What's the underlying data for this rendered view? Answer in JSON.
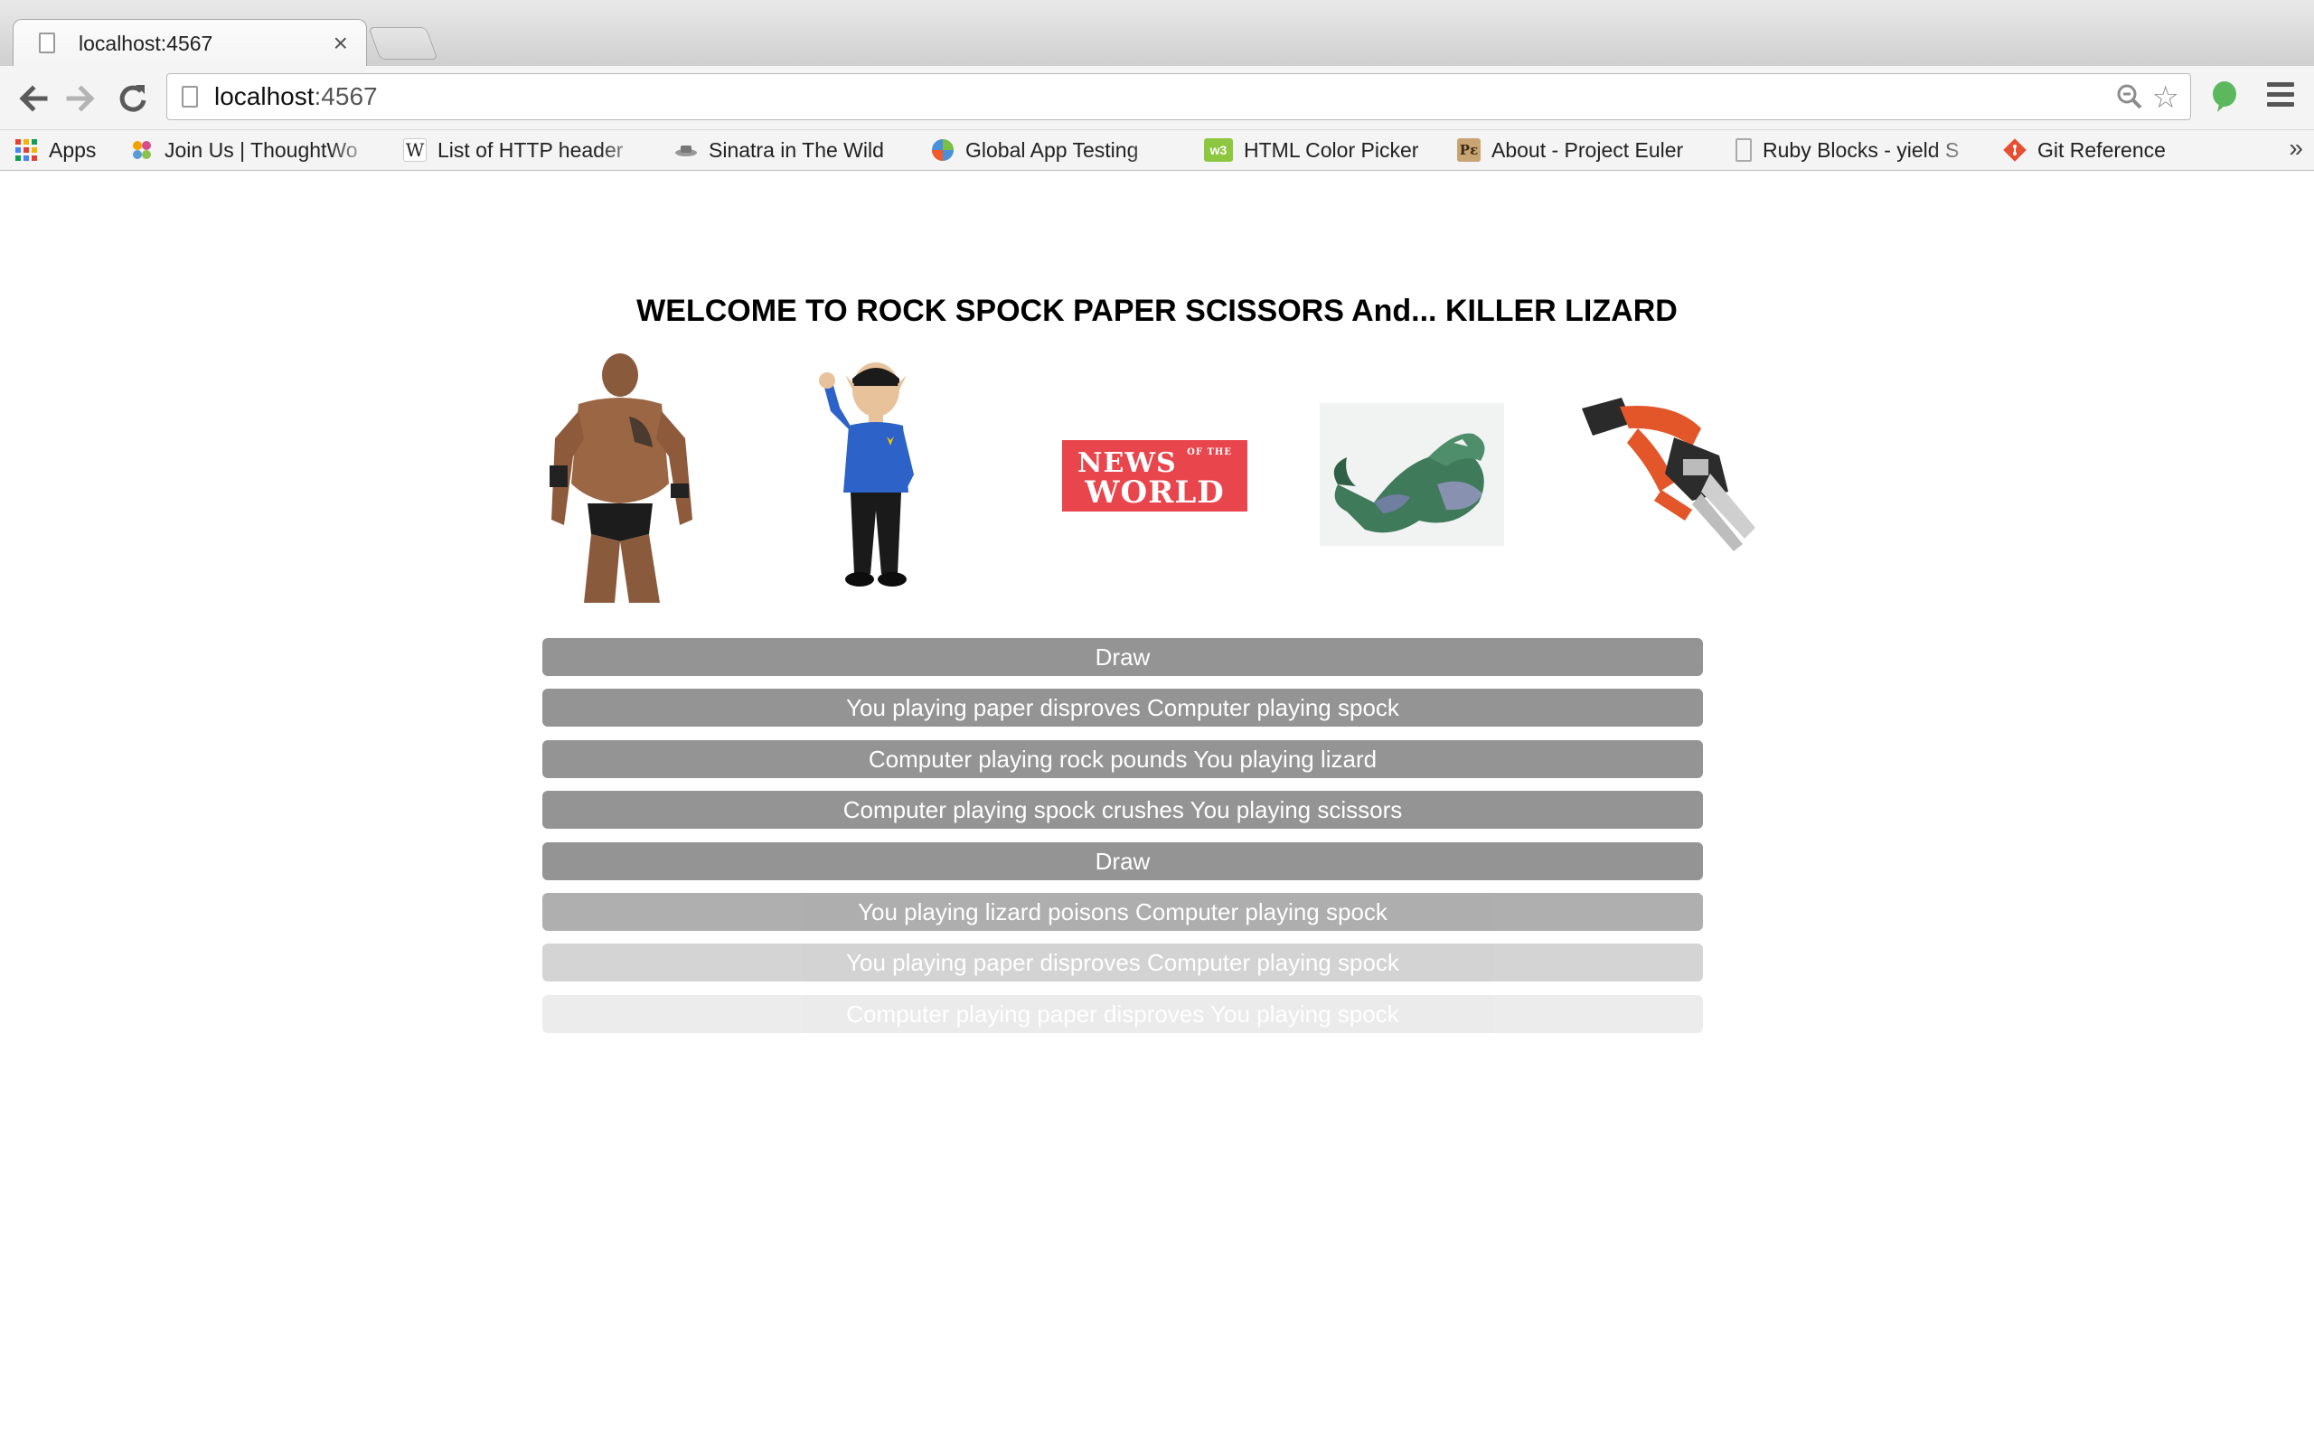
{
  "browser": {
    "tab_title": "localhost:4567",
    "tab_close": "×",
    "url_host": "localhost",
    "url_port": ":4567",
    "back_icon": "arrow-left",
    "forward_icon": "arrow-right",
    "reload_icon": "reload",
    "bookmarks": [
      {
        "label": "Apps",
        "icon": "apps-grid"
      },
      {
        "label": "Join Us | ThoughtWo",
        "icon": "thoughtworks-logo"
      },
      {
        "label": "List of HTTP header",
        "icon": "wikipedia-logo"
      },
      {
        "label": "Sinatra in The Wild",
        "icon": "sinatra-logo"
      },
      {
        "label": "Global App Testing",
        "icon": "globe-logo"
      },
      {
        "label": "HTML Color Picker",
        "icon": "w3-logo"
      },
      {
        "label": "About - Project Euler",
        "icon": "project-euler-logo"
      },
      {
        "label": "Ruby Blocks - yield S",
        "icon": "page-icon"
      },
      {
        "label": "Git Reference",
        "icon": "git-logo"
      }
    ],
    "bookmarks_overflow": "»"
  },
  "page": {
    "heading": "WELCOME TO ROCK SPOCK PAPER SCISSORS And... KILLER LIZARD",
    "choices": [
      {
        "name": "rock",
        "image": "wrestler-image"
      },
      {
        "name": "spock",
        "image": "spock-image"
      },
      {
        "name": "paper",
        "image": "newspaper-logo"
      },
      {
        "name": "lizard",
        "image": "lizard-image"
      },
      {
        "name": "scissors",
        "image": "saw-image"
      }
    ],
    "newspaper_logo": {
      "line1": "NEWS",
      "small": "OF THE",
      "line2": "WORLD"
    },
    "results": [
      {
        "text": "Draw",
        "opacity": 1
      },
      {
        "text": "You playing paper disproves Computer playing spock",
        "opacity": 1
      },
      {
        "text": "Computer playing rock pounds You playing lizard",
        "opacity": 1
      },
      {
        "text": "Computer playing spock crushes You playing scissors",
        "opacity": 1
      },
      {
        "text": "Draw",
        "opacity": 1
      },
      {
        "text": "You playing lizard poisons Computer playing spock",
        "opacity": 0.75
      },
      {
        "text": "You playing paper disproves Computer playing spock",
        "opacity": 0.4
      },
      {
        "text": "Computer playing paper disproves You playing spock",
        "opacity": 0.18
      }
    ]
  },
  "colors": {
    "result_bg": "#949494",
    "newspaper_red": "#e8454c",
    "evernote_green": "#5cb85c"
  }
}
